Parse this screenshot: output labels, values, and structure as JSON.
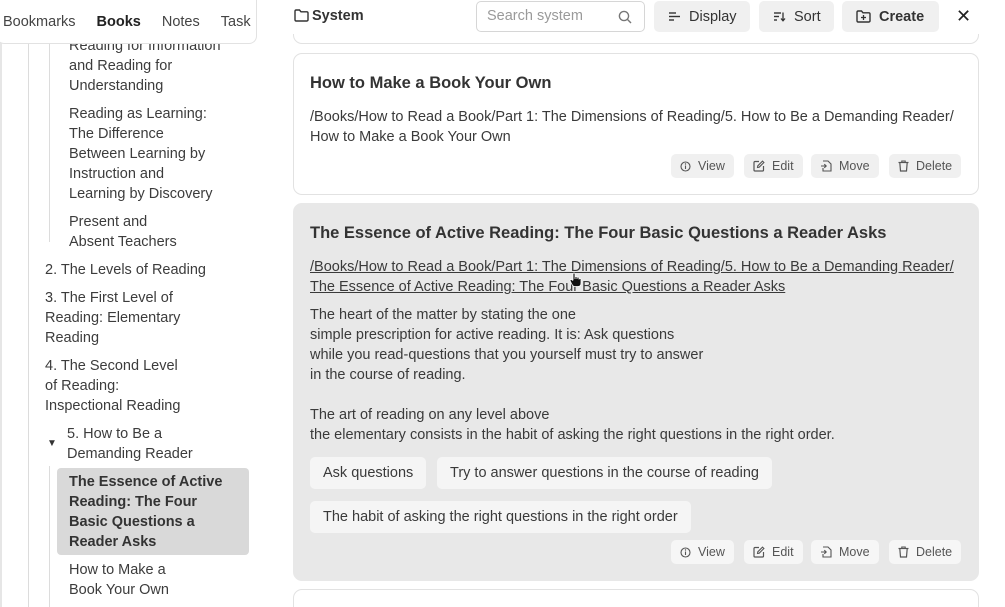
{
  "sidebar": {
    "tabs": [
      {
        "label": "Bookmarks"
      },
      {
        "label": "Books"
      },
      {
        "label": "Notes"
      },
      {
        "label": "Task"
      }
    ],
    "items": [
      {
        "label": "Reading for Information and Reading for Understanding"
      },
      {
        "label": "Reading as Learning: The Difference Between Learning by Instruction and Learning by Discovery"
      },
      {
        "label": "Present and Absent Teachers"
      },
      {
        "label": "2. The Levels of Reading"
      },
      {
        "label": "3. The First Level of Reading: Elementary Reading"
      },
      {
        "label": "4. The Second Level of Reading: Inspectional Reading"
      },
      {
        "label": "5. How to Be a Demanding Reader"
      },
      {
        "label": "The Essence of Active Reading: The Four Basic Questions a Reader Asks"
      },
      {
        "label": "How to Make a Book Your Own"
      }
    ]
  },
  "header": {
    "title": "System",
    "search_placeholder": "Search system",
    "display_label": "Display",
    "sort_label": "Sort",
    "create_label": "Create",
    "close_label": "✕"
  },
  "cards": [
    {
      "title": "How to Make a Book Your Own",
      "path": "/Books/How to Read a Book/Part 1: The Dimensions of Reading/5. How to Be a Demanding Reader/ How to Make a Book Your Own"
    },
    {
      "title": "The Essence of Active Reading: The Four Basic Questions a Reader Asks",
      "path": "/Books/How to Read a Book/Part 1: The Dimensions of Reading/5. How to Be a Demanding Reader/ The Essence of Active Reading: The Four Basic Questions a Reader Asks",
      "body": [
        "The heart of the matter by stating the one",
        "simple prescription for active reading. It is: Ask questions",
        "while you read-questions that you yourself must try to answer",
        "in the course of reading.",
        "The art of reading on any level above",
        "the elementary consists in the habit of asking the right questions in the right order."
      ],
      "tags": [
        "Ask questions",
        "Try to answer questions in the course of reading",
        "The habit of asking the right questions in the right order"
      ]
    }
  ],
  "actions": {
    "view": "View",
    "edit": "Edit",
    "move": "Move",
    "delete": "Delete"
  }
}
